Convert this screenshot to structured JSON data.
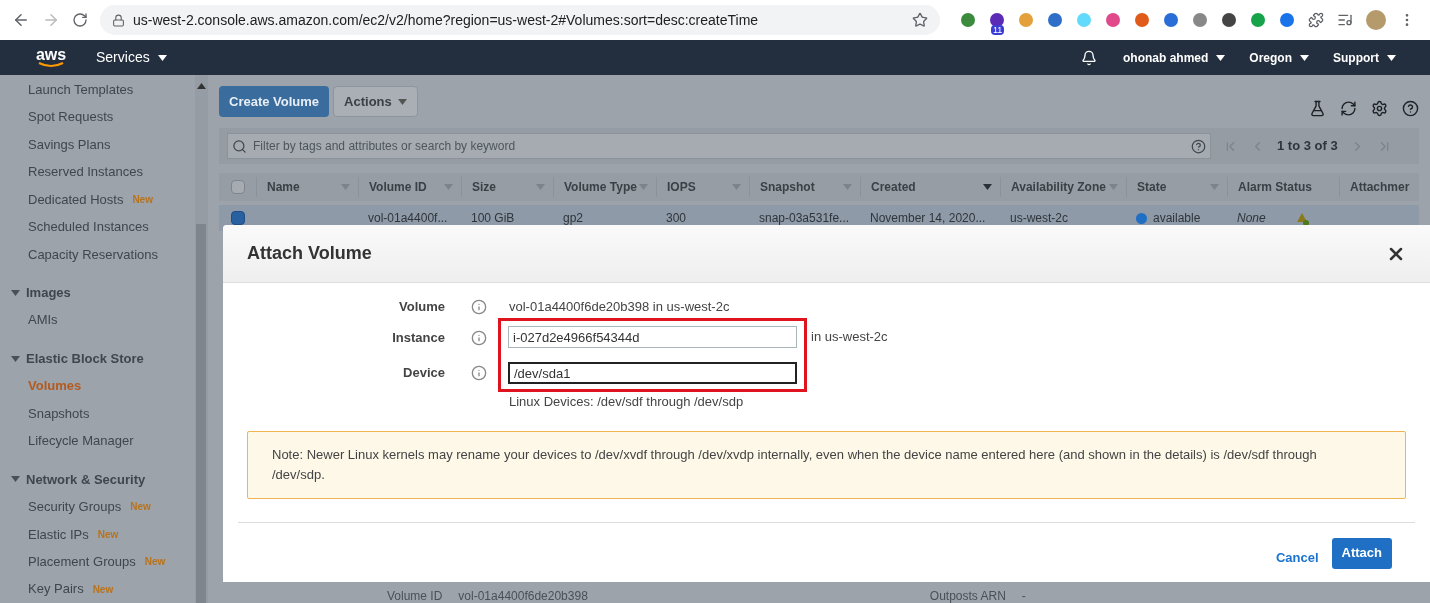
{
  "browser": {
    "url": "us-west-2.console.aws.amazon.com/ec2/v2/home?region=us-west-2#Volumes:sort=desc:createTime",
    "extension_badge": "11"
  },
  "nav": {
    "logo": "aws",
    "services": "Services",
    "user": "ohonab ahmed",
    "region": "Oregon",
    "support": "Support"
  },
  "sidebar": [
    {
      "kind": "item",
      "label": "Launch Templates",
      "selected": false
    },
    {
      "kind": "item",
      "label": "Spot Requests",
      "selected": false
    },
    {
      "kind": "item",
      "label": "Savings Plans",
      "selected": false
    },
    {
      "kind": "item",
      "label": "Reserved Instances",
      "selected": false
    },
    {
      "kind": "item",
      "label": "Dedicated Hosts",
      "badge": "New",
      "selected": false
    },
    {
      "kind": "item",
      "label": "Scheduled Instances",
      "selected": false
    },
    {
      "kind": "item",
      "label": "Capacity Reservations",
      "selected": false
    },
    {
      "kind": "section",
      "label": "Images",
      "expanded": true
    },
    {
      "kind": "item",
      "label": "AMIs",
      "selected": false
    },
    {
      "kind": "section",
      "label": "Elastic Block Store",
      "expanded": true
    },
    {
      "kind": "item",
      "label": "Volumes",
      "selected": true
    },
    {
      "kind": "item",
      "label": "Snapshots",
      "selected": false
    },
    {
      "kind": "item",
      "label": "Lifecycle Manager",
      "selected": false
    },
    {
      "kind": "section",
      "label": "Network & Security",
      "expanded": true
    },
    {
      "kind": "item",
      "label": "Security Groups",
      "badge": "New",
      "selected": false
    },
    {
      "kind": "item",
      "label": "Elastic IPs",
      "badge": "New",
      "selected": false
    },
    {
      "kind": "item",
      "label": "Placement Groups",
      "badge": "New",
      "selected": false
    },
    {
      "kind": "item",
      "label": "Key Pairs",
      "badge": "New",
      "selected": false
    }
  ],
  "toolbar": {
    "create": "Create Volume",
    "actions": "Actions"
  },
  "filter": {
    "placeholder": "Filter by tags and attributes or search by keyword",
    "pagination": "1 to 3 of 3"
  },
  "table": {
    "all_selected": false,
    "columns": [
      {
        "label": "Name",
        "sortable": true,
        "sorted": false
      },
      {
        "label": "Volume ID",
        "sortable": true,
        "sorted": false
      },
      {
        "label": "Size",
        "sortable": true,
        "sorted": false
      },
      {
        "label": "Volume Type",
        "sortable": true,
        "sorted": false
      },
      {
        "label": "IOPS",
        "sortable": true,
        "sorted": false
      },
      {
        "label": "Snapshot",
        "sortable": true,
        "sorted": false
      },
      {
        "label": "Created",
        "sortable": true,
        "sorted": true
      },
      {
        "label": "Availability Zone",
        "sortable": true,
        "sorted": false
      },
      {
        "label": "State",
        "sortable": true,
        "sorted": false
      },
      {
        "label": "Alarm Status",
        "sortable": false
      },
      {
        "label": "Attachmer",
        "sortable": false
      }
    ],
    "rows": [
      {
        "selected": true,
        "cells": [
          "",
          "vol-01a4400f...",
          "100 GiB",
          "gp2",
          "300",
          "snap-03a531fe...",
          "November 14, 2020...",
          "us-west-2c",
          "available",
          "None",
          ""
        ]
      }
    ]
  },
  "details": {
    "volume_id_label": "Volume ID",
    "volume_id": "vol-01a4400f6de20b398",
    "outposts_label": "Outposts ARN",
    "outposts": "-"
  },
  "modal": {
    "title": "Attach Volume",
    "highlight_fields": true,
    "volume": {
      "label": "Volume",
      "value": "vol-01a4400f6de20b398 in us-west-2c"
    },
    "instance": {
      "label": "Instance",
      "value": "i-027d2e4966f54344d",
      "suffix": "in us-west-2c",
      "focused": false
    },
    "device": {
      "label": "Device",
      "value": "/dev/sda1",
      "focused": true
    },
    "hint": "Linux Devices: /dev/sdf through /dev/sdp",
    "note": "Note: Newer Linux kernels may rename your devices to /dev/xvdf through /dev/xvdp internally, even when the device name entered here (and shown in the details) is /dev/sdf through /dev/sdp.",
    "cancel": "Cancel",
    "attach": "Attach"
  }
}
